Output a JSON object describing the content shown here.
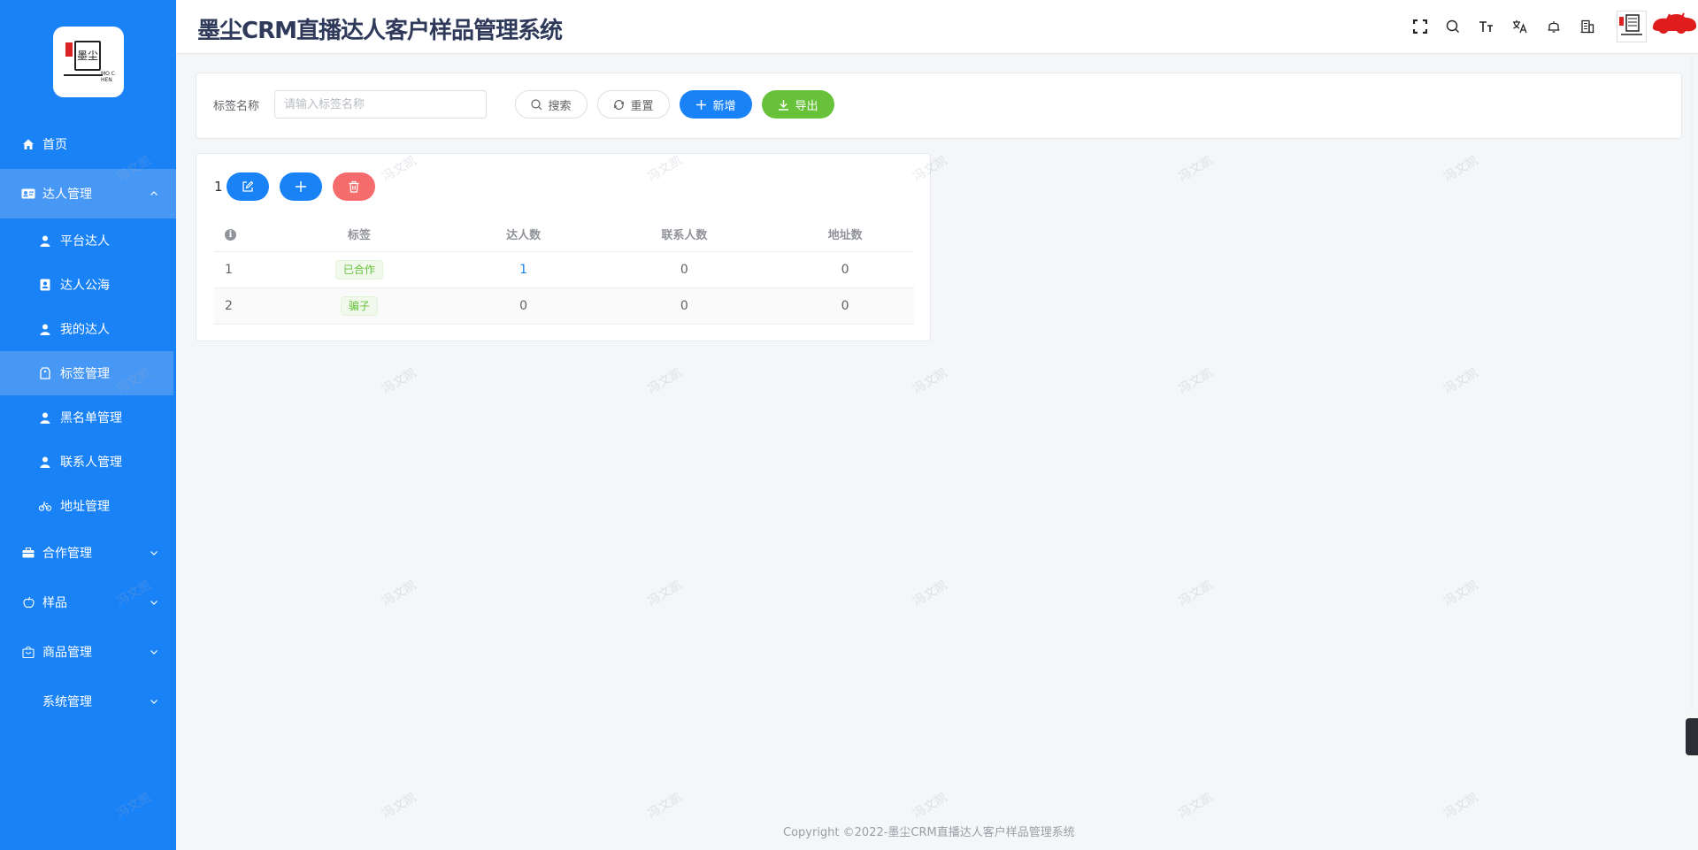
{
  "app": {
    "title": "墨尘CRM直播达人客户样品管理系统",
    "logo_text": "墨尘",
    "logo_sub": "MO CHEN",
    "footer": "Copyright ©2022-墨尘CRM直播达人客户样品管理系统",
    "watermark": "冯文凯"
  },
  "colors": {
    "sidebar": "#1a82f7",
    "primary": "#1a82f7",
    "success": "#67c23a",
    "danger": "#f56c6c",
    "active_bg": "#4797f5"
  },
  "sidebar": {
    "items": [
      {
        "label": "首页",
        "icon": "home-icon"
      },
      {
        "label": "达人管理",
        "icon": "id-card-icon",
        "expanded": true
      },
      {
        "label": "合作管理",
        "icon": "briefcase-icon"
      },
      {
        "label": "样品",
        "icon": "apple-icon"
      },
      {
        "label": "商品管理",
        "icon": "bag-icon"
      },
      {
        "label": "系统管理",
        "icon": ""
      }
    ],
    "sub_items": [
      {
        "label": "平台达人",
        "icon": "user-icon"
      },
      {
        "label": "达人公海",
        "icon": "contact-book-icon"
      },
      {
        "label": "我的达人",
        "icon": "user-icon"
      },
      {
        "label": "标签管理",
        "icon": "tag-icon",
        "active": true
      },
      {
        "label": "黑名单管理",
        "icon": "user-icon"
      },
      {
        "label": "联系人管理",
        "icon": "user-icon"
      },
      {
        "label": "地址管理",
        "icon": "bike-icon"
      }
    ]
  },
  "header_icons": [
    "fullscreen-icon",
    "search-icon",
    "font-size-icon",
    "translate-icon",
    "bell-icon",
    "building-icon"
  ],
  "search": {
    "label": "标签名称",
    "placeholder": "请输入标签名称",
    "value": "",
    "search_btn": "搜索",
    "reset_btn": "重置",
    "add_btn": "新增",
    "export_btn": "导出"
  },
  "table": {
    "selected_count": "1",
    "columns": [
      "",
      "标签",
      "达人数",
      "联系人数",
      "地址数"
    ],
    "rows": [
      {
        "index": "1",
        "tag": "已合作",
        "influencers": "1",
        "contacts": "0",
        "addresses": "0"
      },
      {
        "index": "2",
        "tag": "骗子",
        "influencers": "0",
        "contacts": "0",
        "addresses": "0"
      }
    ]
  }
}
